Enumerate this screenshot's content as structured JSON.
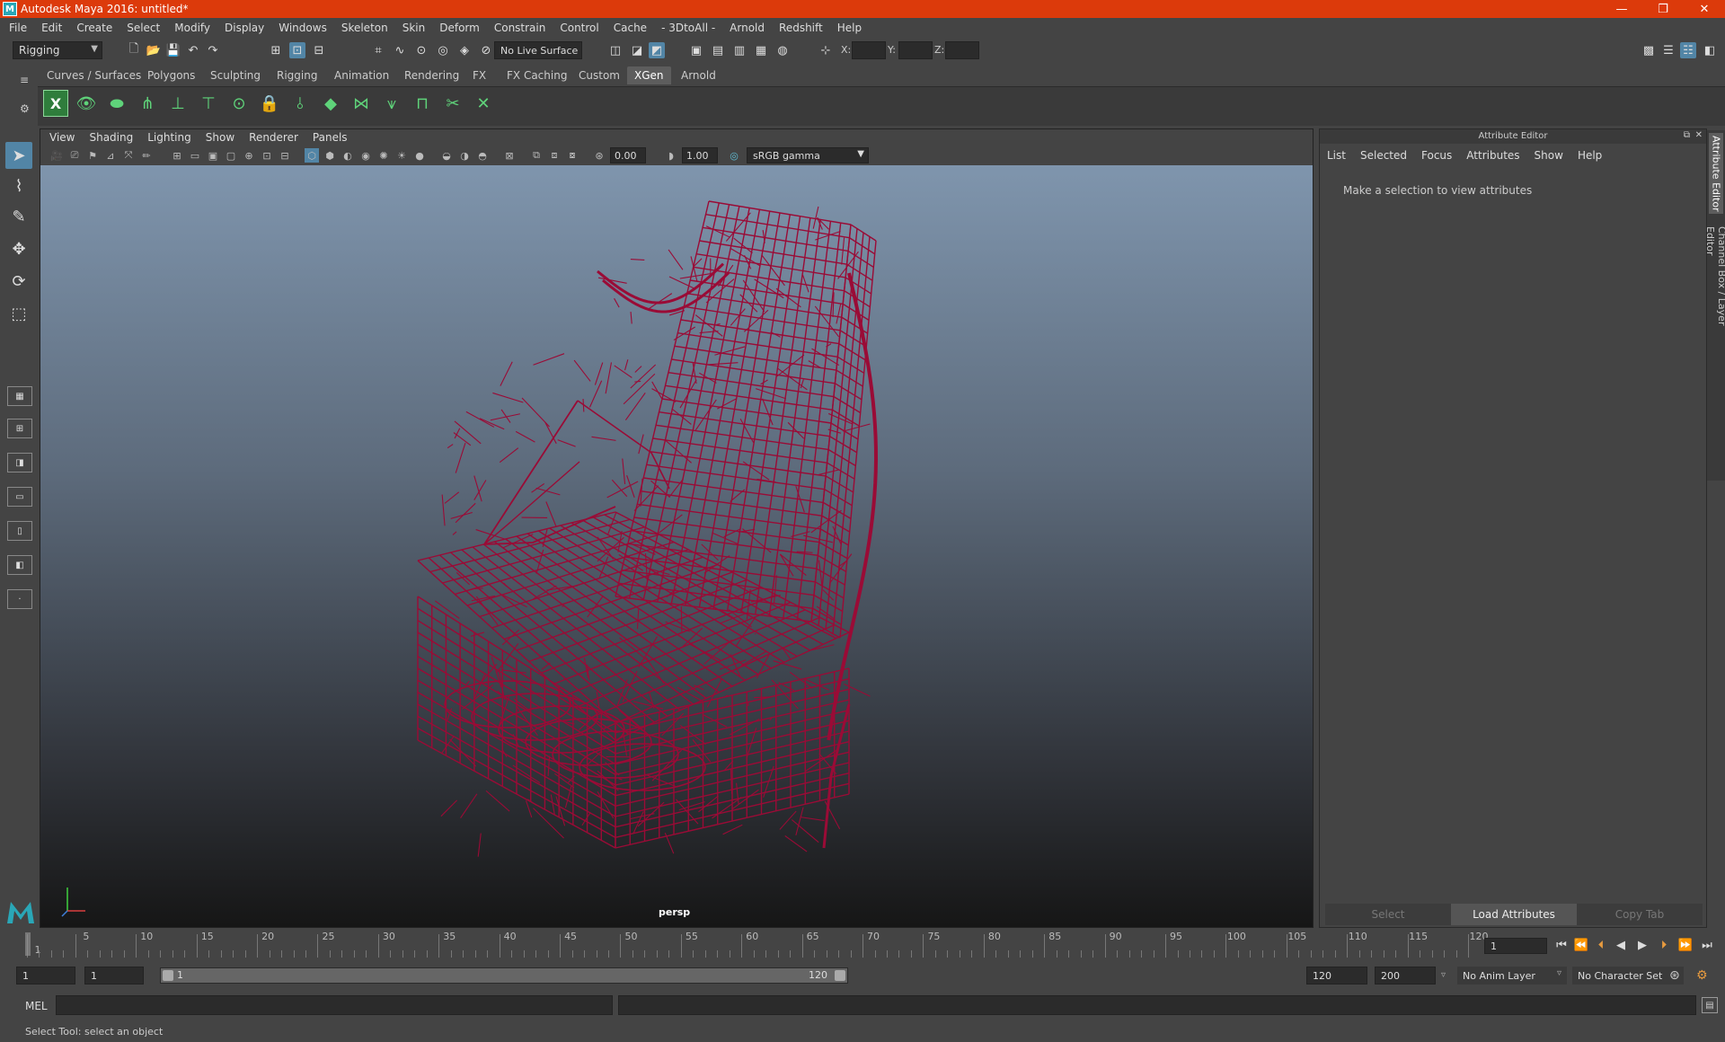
{
  "window": {
    "title": "Autodesk Maya 2016: untitled*",
    "controls": [
      "—",
      "❐",
      "✕"
    ]
  },
  "menubar": [
    "File",
    "Edit",
    "Create",
    "Select",
    "Modify",
    "Display",
    "Windows",
    "Skeleton",
    "Skin",
    "Deform",
    "Constrain",
    "Control",
    "Cache",
    "- 3DtoAll -",
    "Arnold",
    "Redshift",
    "Help"
  ],
  "toolbar": {
    "mode": "Rigging",
    "live_surface": "No Live Surface",
    "x_label": "X:",
    "y_label": "Y:",
    "z_label": "Z:"
  },
  "shelf": {
    "tabs": [
      "Curves / Surfaces",
      "Polygons",
      "Sculpting",
      "Rigging",
      "Animation",
      "Rendering",
      "FX",
      "FX Caching",
      "Custom",
      "XGen",
      "Arnold"
    ],
    "active_tab": "XGen"
  },
  "viewport": {
    "menu": [
      "View",
      "Shading",
      "Lighting",
      "Show",
      "Renderer",
      "Panels"
    ],
    "exposure": "0.00",
    "gamma": "1.00",
    "color_space": "sRGB gamma",
    "camera": "persp",
    "wire_color": "#9a0b36"
  },
  "attribute_editor": {
    "title": "Attribute Editor",
    "menu": [
      "List",
      "Selected",
      "Focus",
      "Attributes",
      "Show",
      "Help"
    ],
    "message": "Make a selection to view attributes",
    "buttons": [
      "Select",
      "Load Attributes",
      "Copy Tab"
    ],
    "side_tabs": [
      "Attribute Editor",
      "Channel Box / Layer Editor"
    ]
  },
  "timeline": {
    "ticks": [
      1,
      5,
      10,
      15,
      20,
      25,
      30,
      35,
      40,
      45,
      50,
      55,
      60,
      65,
      70,
      75,
      80,
      85,
      90,
      95,
      100,
      105,
      110,
      115,
      120
    ],
    "current_frame": "1",
    "range_start": "1",
    "range_start2": "1",
    "slider_start": "1",
    "slider_end": "120",
    "playback_end": "120",
    "anim_end": "200",
    "anim_layer": "No Anim Layer",
    "char_set": "No Character Set"
  },
  "command": {
    "label": "MEL"
  },
  "status": {
    "help": "Select Tool: select an object"
  }
}
